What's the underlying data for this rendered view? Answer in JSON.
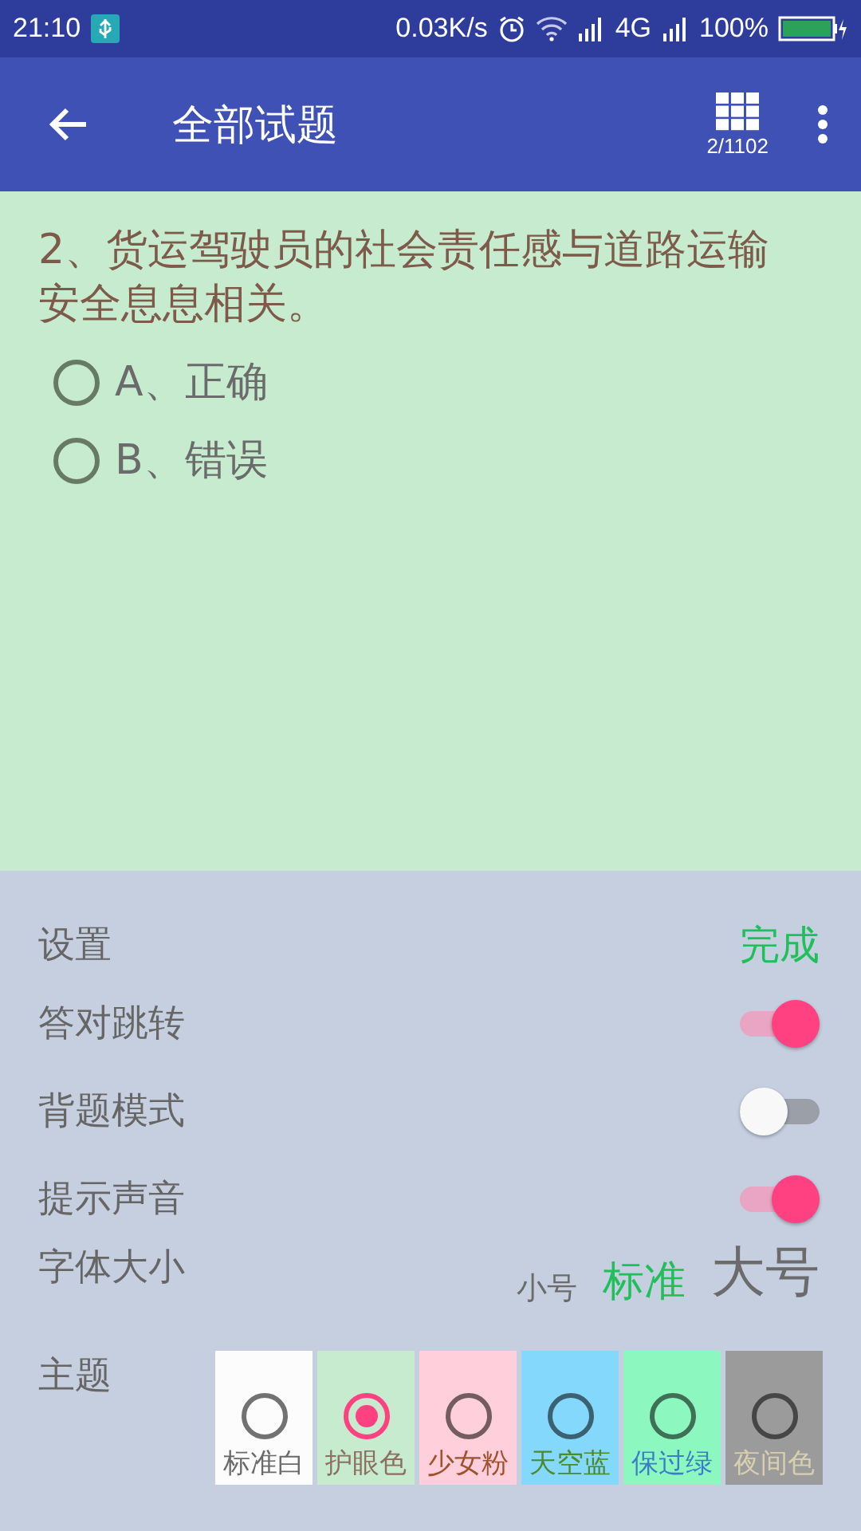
{
  "status_bar": {
    "time": "21:10",
    "speed": "0.03K/s",
    "network": "4G",
    "battery": "100%"
  },
  "app_bar": {
    "title": "全部试题",
    "progress": "2/1102"
  },
  "question": {
    "text": "2、货运驾驶员的社会责任感与道路运输安全息息相关。",
    "options": [
      {
        "label": "A、正确",
        "selected": false
      },
      {
        "label": "B、错误",
        "selected": false
      }
    ]
  },
  "settings": {
    "title": "设置",
    "done": "完成",
    "toggles": [
      {
        "label": "答对跳转",
        "on": true
      },
      {
        "label": "背题模式",
        "on": false
      },
      {
        "label": "提示声音",
        "on": true
      }
    ],
    "font_size": {
      "label": "字体大小",
      "options": [
        {
          "label": "小号",
          "selected": false
        },
        {
          "label": "标准",
          "selected": true
        },
        {
          "label": "大号",
          "selected": false
        }
      ]
    },
    "theme": {
      "label": "主题",
      "options": [
        {
          "name": {
            "text": "标准白",
            "color": "#6b6b6b"
          },
          "selected": false,
          "color": "#fcfcfc"
        },
        {
          "name": {
            "text": "护眼色",
            "color": "#8d6e63"
          },
          "selected": true,
          "color": "#c7ebce"
        },
        {
          "name": {
            "text": "少女粉",
            "color": "#a0522d"
          },
          "selected": false,
          "color": "#ffcfdc"
        },
        {
          "name": {
            "text": "天空蓝",
            "color": "#4c8a2c"
          },
          "selected": false,
          "color": "#84d8fc"
        },
        {
          "name": {
            "text": "保过绿",
            "color": "#3a7fc6"
          },
          "selected": false,
          "color": "#8cf8c0"
        },
        {
          "name": {
            "text": "夜间色",
            "color": "#d8cfb0"
          },
          "selected": false,
          "color": "#9b9b9b"
        }
      ]
    }
  }
}
